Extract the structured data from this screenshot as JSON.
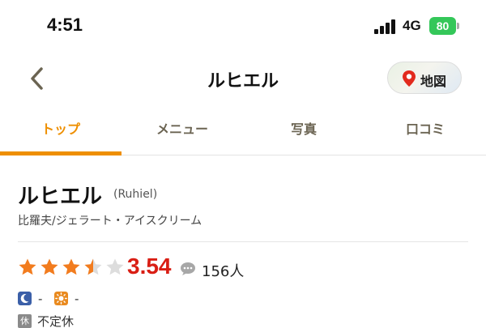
{
  "status_bar": {
    "time": "4:51",
    "network": "4G",
    "battery": "80"
  },
  "header": {
    "title": "ルヒエル",
    "map_label": "地図"
  },
  "tabs": [
    {
      "label": "トップ",
      "active": true
    },
    {
      "label": "メニュー",
      "active": false
    },
    {
      "label": "写真",
      "active": false
    },
    {
      "label": "口コミ",
      "active": false
    }
  ],
  "shop": {
    "name": "ルヒエル",
    "name_roman": "(Ruhiel)",
    "genre": "比羅夫/ジェラート・アイスクリーム",
    "rating_stars": 3.5,
    "rating": "3.54",
    "review_count": "156人"
  },
  "hours": {
    "dinner": "-",
    "lunch": "-"
  },
  "holiday": {
    "badge": "休",
    "text": "不定休"
  },
  "colors": {
    "accent": "#ee8f00",
    "rating": "#d91e14",
    "star": "#f27c1e",
    "battery": "#34c759"
  }
}
